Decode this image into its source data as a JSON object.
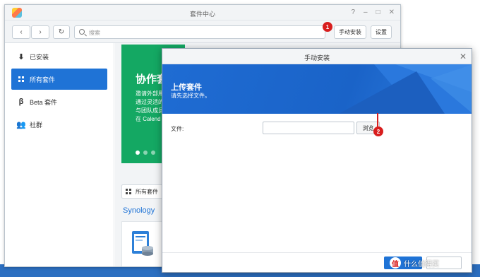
{
  "window": {
    "title": "套件中心",
    "controls": [
      "?",
      "–",
      "□",
      "✕"
    ]
  },
  "toolbar": {
    "search_placeholder": "搜索",
    "manual_install_label": "手动安装",
    "settings_label": "设置"
  },
  "sidebar": {
    "items": [
      {
        "label": "已安装",
        "icon": "download-icon"
      },
      {
        "label": "所有套件",
        "icon": "grid-icon"
      },
      {
        "label": "Beta 套件",
        "icon": "beta-icon"
      },
      {
        "label": "社群",
        "icon": "community-icon"
      }
    ],
    "active_index": 1
  },
  "banner": {
    "title": "协作套",
    "lines": [
      "邀请外部用",
      "通过灵活的",
      "与团队成员",
      "在 Calend"
    ]
  },
  "main": {
    "all_packages_tab": "所有套件",
    "vendor_heading": "Synology"
  },
  "dialog": {
    "title": "手动安装",
    "header_title": "上传套件",
    "header_subtitle": "请先选择文件。",
    "file_label": "文件:",
    "file_value": "",
    "browse_label": "浏览"
  },
  "annotations": {
    "step1": "1",
    "step2": "2"
  },
  "watermark": {
    "icon_text": "值",
    "text": "什么值得买"
  },
  "colors": {
    "accent": "#1f73d6",
    "banner_green": "#14a863",
    "badge_red": "#d81e1e",
    "desktop_blue": "#2c6fc1"
  }
}
